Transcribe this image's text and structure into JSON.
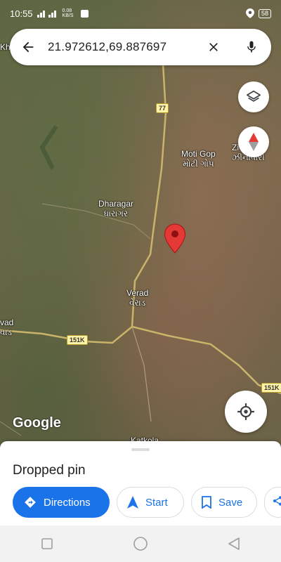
{
  "status_bar": {
    "time": "10:55",
    "network": "0.08 KB/S",
    "battery": "58"
  },
  "search": {
    "query": "21.972612,69.887697"
  },
  "map": {
    "labels": [
      {
        "en": "Moti Gop",
        "local": "મોટી ગોપ"
      },
      {
        "en": "Dharagar",
        "local": "ધારાગર"
      },
      {
        "en": "Verad",
        "local": "વેરાડ"
      },
      {
        "en": "Katkola",
        "local": ""
      },
      {
        "en": "Zi",
        "local": "ઝીનાવારી"
      },
      {
        "en": "Kha",
        "local": ""
      },
      {
        "en": "vad",
        "local": "વાડ"
      }
    ],
    "road_shields": [
      "77",
      "151K",
      "151K"
    ],
    "attribution": "Google"
  },
  "sheet": {
    "title": "Dropped pin",
    "actions": {
      "directions": "Directions",
      "start": "Start",
      "save": "Save"
    }
  },
  "colors": {
    "accent": "#1a73e8",
    "pin": "#e53935"
  }
}
